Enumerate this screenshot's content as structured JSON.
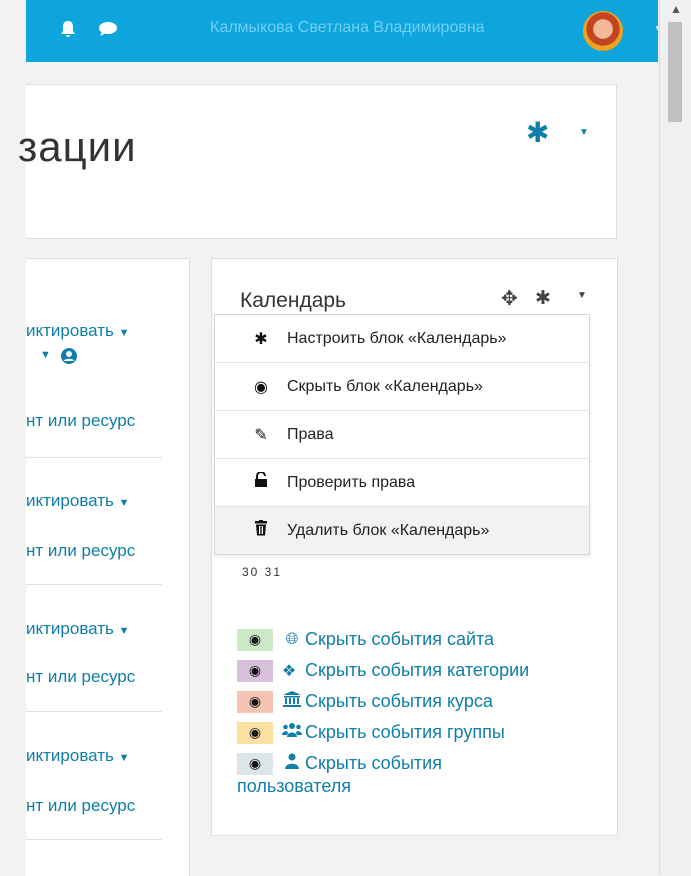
{
  "topbar": {
    "bell_icon": "bell-icon",
    "chat_icon": "chat-icon",
    "user_name": "Калмыкова Светлана Владимировна",
    "bg_color": "#0ea5dd"
  },
  "header": {
    "title_fragment": "зации"
  },
  "left_column": {
    "items": [
      {
        "edit": "иктировать",
        "add": "нт или ресурс"
      },
      {
        "edit": "иктировать",
        "add": "нт или ресурс"
      },
      {
        "edit": "иктировать",
        "add": "нт или ресурс"
      },
      {
        "edit": "иктировать",
        "add": "нт или ресурс"
      }
    ]
  },
  "calendar": {
    "title": "Календарь",
    "days_partial": "30     31",
    "menu": [
      {
        "icon": "gear-icon",
        "label": "Настроить блок «Календарь»"
      },
      {
        "icon": "eye-icon",
        "label": "Скрыть блок «Календарь»"
      },
      {
        "icon": "edit-icon",
        "label": "Права"
      },
      {
        "icon": "unlock-icon",
        "label": "Проверить права"
      },
      {
        "icon": "trash-icon",
        "label": "Удалить блок «Календарь»"
      }
    ],
    "events": [
      {
        "label": "Скрыть события сайта",
        "icon": "globe-icon",
        "color": "#cce8c6"
      },
      {
        "label": "Скрыть события категории",
        "icon": "cubes-icon",
        "color": "#d8bfdc"
      },
      {
        "label": "Скрыть события курса",
        "icon": "university-icon",
        "color": "#f6c4b2"
      },
      {
        "label": "Скрыть события группы",
        "icon": "users-icon",
        "color": "#fbe1a1"
      },
      {
        "label": "Скрыть события",
        "label_2": "пользователя",
        "icon": "user-icon",
        "color": "#dbe5ea"
      }
    ]
  }
}
